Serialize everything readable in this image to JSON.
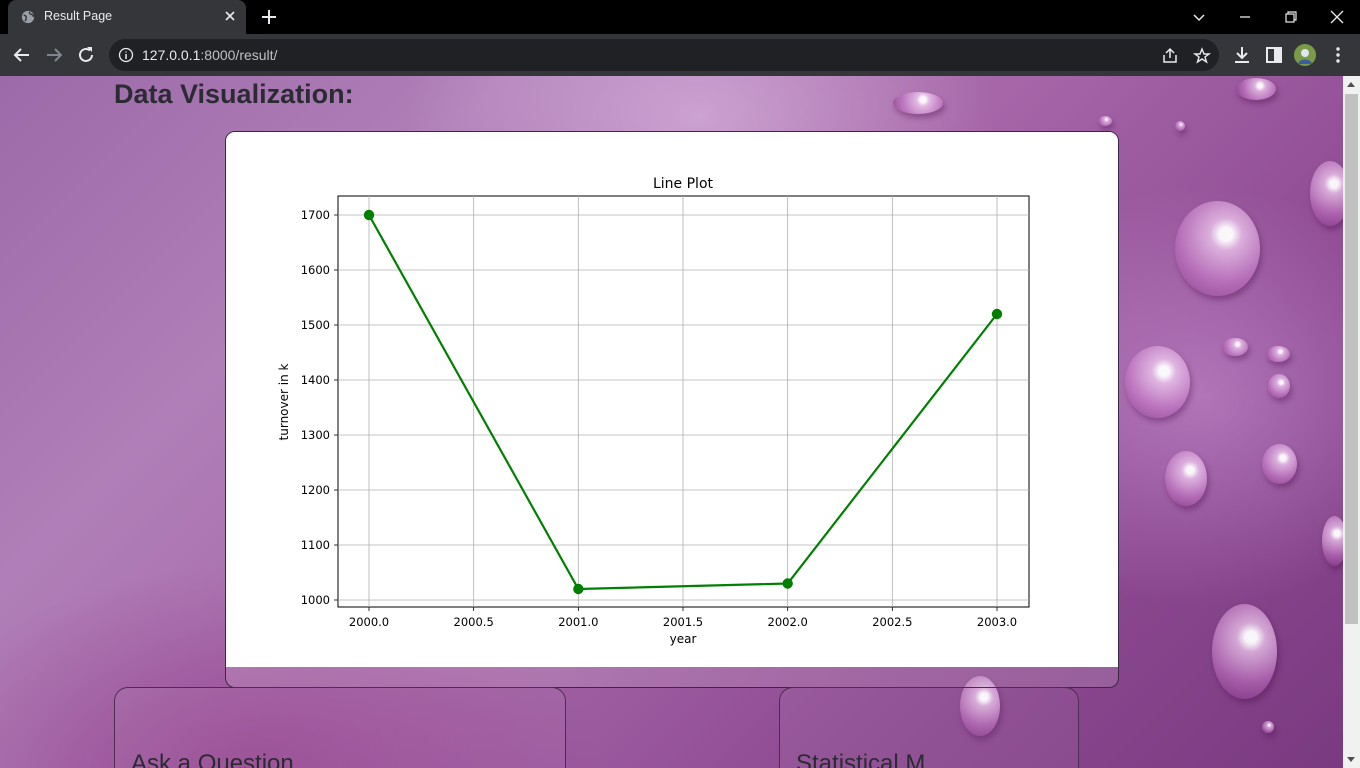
{
  "browser": {
    "tab_title": "Result Page",
    "url_host": "127.0.0.1",
    "url_rest": ":8000/result/"
  },
  "page": {
    "heading": "Data Visualization:",
    "card_left_label": "Ask a Question",
    "card_right_label": "Statistical M"
  },
  "chart_data": {
    "type": "line",
    "title": "Line Plot",
    "xlabel": "year",
    "ylabel": "turnover in k",
    "x": [
      2000.0,
      2001.0,
      2002.0,
      2003.0
    ],
    "y": [
      1700,
      1020,
      1030,
      1520
    ],
    "xlim": [
      2000.0,
      2003.0
    ],
    "ylim": [
      1000,
      1700
    ],
    "xticks": [
      "2000.0",
      "2000.5",
      "2001.0",
      "2001.5",
      "2002.0",
      "2002.5",
      "2003.0"
    ],
    "yticks": [
      "1000",
      "1100",
      "1200",
      "1300",
      "1400",
      "1500",
      "1600",
      "1700"
    ],
    "color": "#008000",
    "grid": true,
    "marker": "circle"
  }
}
